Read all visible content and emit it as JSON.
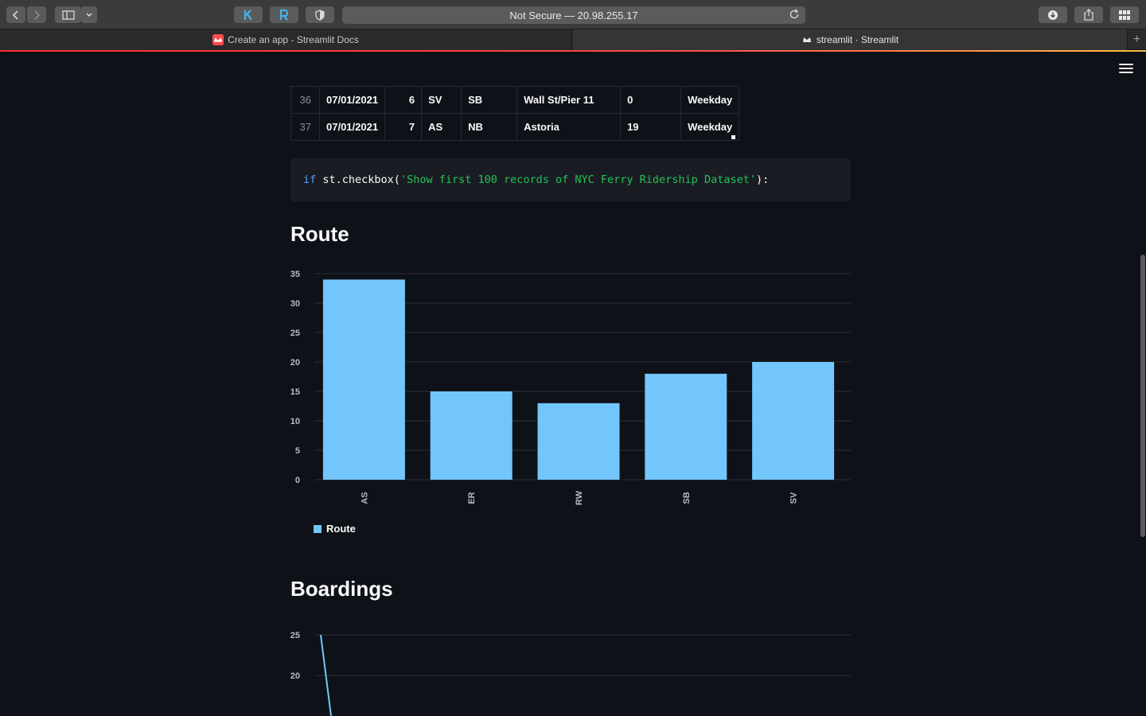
{
  "browser": {
    "url_text": "Not Secure — 20.98.255.17",
    "tabs": [
      {
        "title": "Create an app - Streamlit Docs",
        "active": false
      },
      {
        "title": "streamlit · Streamlit",
        "active": true
      }
    ]
  },
  "table": {
    "rows": [
      {
        "index": "36",
        "date": "07/01/2021",
        "hour": "6",
        "route": "SV",
        "direction": "SB",
        "stop": "Wall St/Pier 11",
        "boardings": "0",
        "daytype": "Weekday"
      },
      {
        "index": "37",
        "date": "07/01/2021",
        "hour": "7",
        "route": "AS",
        "direction": "NB",
        "stop": "Astoria",
        "boardings": "19",
        "daytype": "Weekday"
      }
    ]
  },
  "code": {
    "keyword": "if",
    "call": " st.checkbox(",
    "string": "'Show first 100 records of NYC Ferry Ridership Dataset'",
    "tail": "):"
  },
  "sections": {
    "route_title": "Route",
    "boardings_title": "Boardings"
  },
  "colors": {
    "bar": "#73c6fc",
    "grid": "#2c2f37",
    "axis_text": "#b8bcc4"
  },
  "chart_data": [
    {
      "type": "bar",
      "categories": [
        "AS",
        "ER",
        "RW",
        "SB",
        "SV"
      ],
      "series": [
        {
          "name": "Route",
          "values": [
            34,
            15,
            13,
            18,
            20
          ]
        }
      ],
      "yticks": [
        0,
        5,
        10,
        15,
        20,
        25,
        30,
        35
      ],
      "ylim": [
        0,
        35
      ],
      "legend": "bottom-left",
      "grid": true
    },
    {
      "type": "line",
      "yticks": [
        20,
        25
      ],
      "partial": true,
      "grid": true
    }
  ]
}
